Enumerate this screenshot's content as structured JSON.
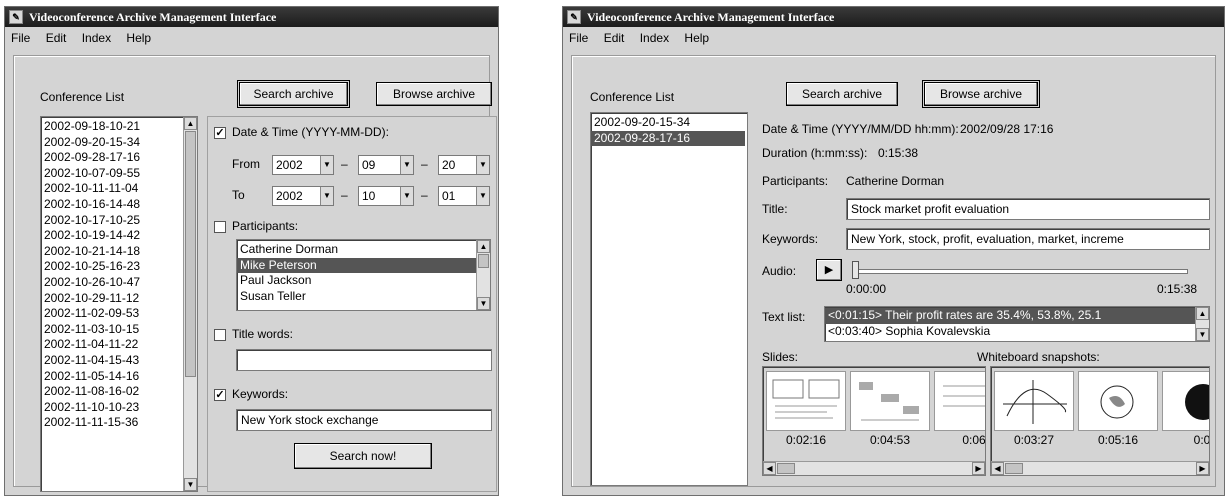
{
  "window_title": "Videoconference Archive Management Interface",
  "menu": [
    "File",
    "Edit",
    "Index",
    "Help"
  ],
  "search_window": {
    "conference_list_label": "Conference List",
    "search_button": "Search archive",
    "browse_button": "Browse archive",
    "conferences": [
      "2002-09-18-10-21",
      "2002-09-20-15-34",
      "2002-09-28-17-16",
      "2002-10-07-09-55",
      "2002-10-11-11-04",
      "2002-10-16-14-48",
      "2002-10-17-10-25",
      "2002-10-19-14-42",
      "2002-10-21-14-18",
      "2002-10-25-16-23",
      "2002-10-26-10-47",
      "2002-10-29-11-12",
      "2002-11-02-09-53",
      "2002-11-03-10-15",
      "2002-11-04-11-22",
      "2002-11-04-15-43",
      "2002-11-05-14-16",
      "2002-11-08-16-02",
      "2002-11-10-10-23",
      "2002-11-11-15-36"
    ],
    "datetime_label": "Date & Time (YYYY-MM-DD):",
    "datetime_checked": true,
    "from_label": "From",
    "to_label": "To",
    "from": {
      "year": "2002",
      "month": "09",
      "day": "20"
    },
    "to": {
      "year": "2002",
      "month": "10",
      "day": "01"
    },
    "dash": "–",
    "participants_label": "Participants:",
    "participants_checked": false,
    "participants": [
      "Catherine Dorman",
      "Mike Peterson",
      "Paul Jackson",
      "Susan Teller"
    ],
    "selected_participant": "Mike Peterson",
    "title_words_label": "Title words:",
    "title_words_checked": false,
    "title_words_value": "",
    "keywords_label": "Keywords:",
    "keywords_checked": true,
    "keywords_value": "New York stock exchange",
    "search_now_button": "Search now!"
  },
  "browse_window": {
    "conference_list_label": "Conference List",
    "search_button": "Search archive",
    "browse_button": "Browse archive",
    "conferences": [
      "2002-09-20-15-34",
      "2002-09-28-17-16"
    ],
    "selected_conference": "2002-09-28-17-16",
    "datetime_label": "Date & Time (YYYY/MM/DD hh:mm):",
    "datetime_value": "2002/09/28 17:16",
    "duration_label": "Duration (h:mm:ss):",
    "duration_value": "0:15:38",
    "participants_label": "Participants:",
    "participants_value": "Catherine Dorman",
    "title_label": "Title:",
    "title_value": "Stock market profit evaluation",
    "keywords_label": "Keywords:",
    "keywords_value": "New York, stock, profit, evaluation, market, increme",
    "audio_label": "Audio:",
    "audio_position": 0.0,
    "audio_start": "0:00:00",
    "audio_end": "0:15:38",
    "text_list_label": "Text list:",
    "text_list": [
      "<0:01:15> Their profit rates are 35.4%, 53.8%, 25.1",
      "<0:03:40> Sophia Kovalevskia"
    ],
    "slides_label": "Slides:",
    "slides": [
      "0:02:16",
      "0:04:53",
      "0:06"
    ],
    "whiteboard_label": "Whiteboard snapshots:",
    "whiteboard": [
      "0:03:27",
      "0:05:16",
      "0:0"
    ]
  }
}
